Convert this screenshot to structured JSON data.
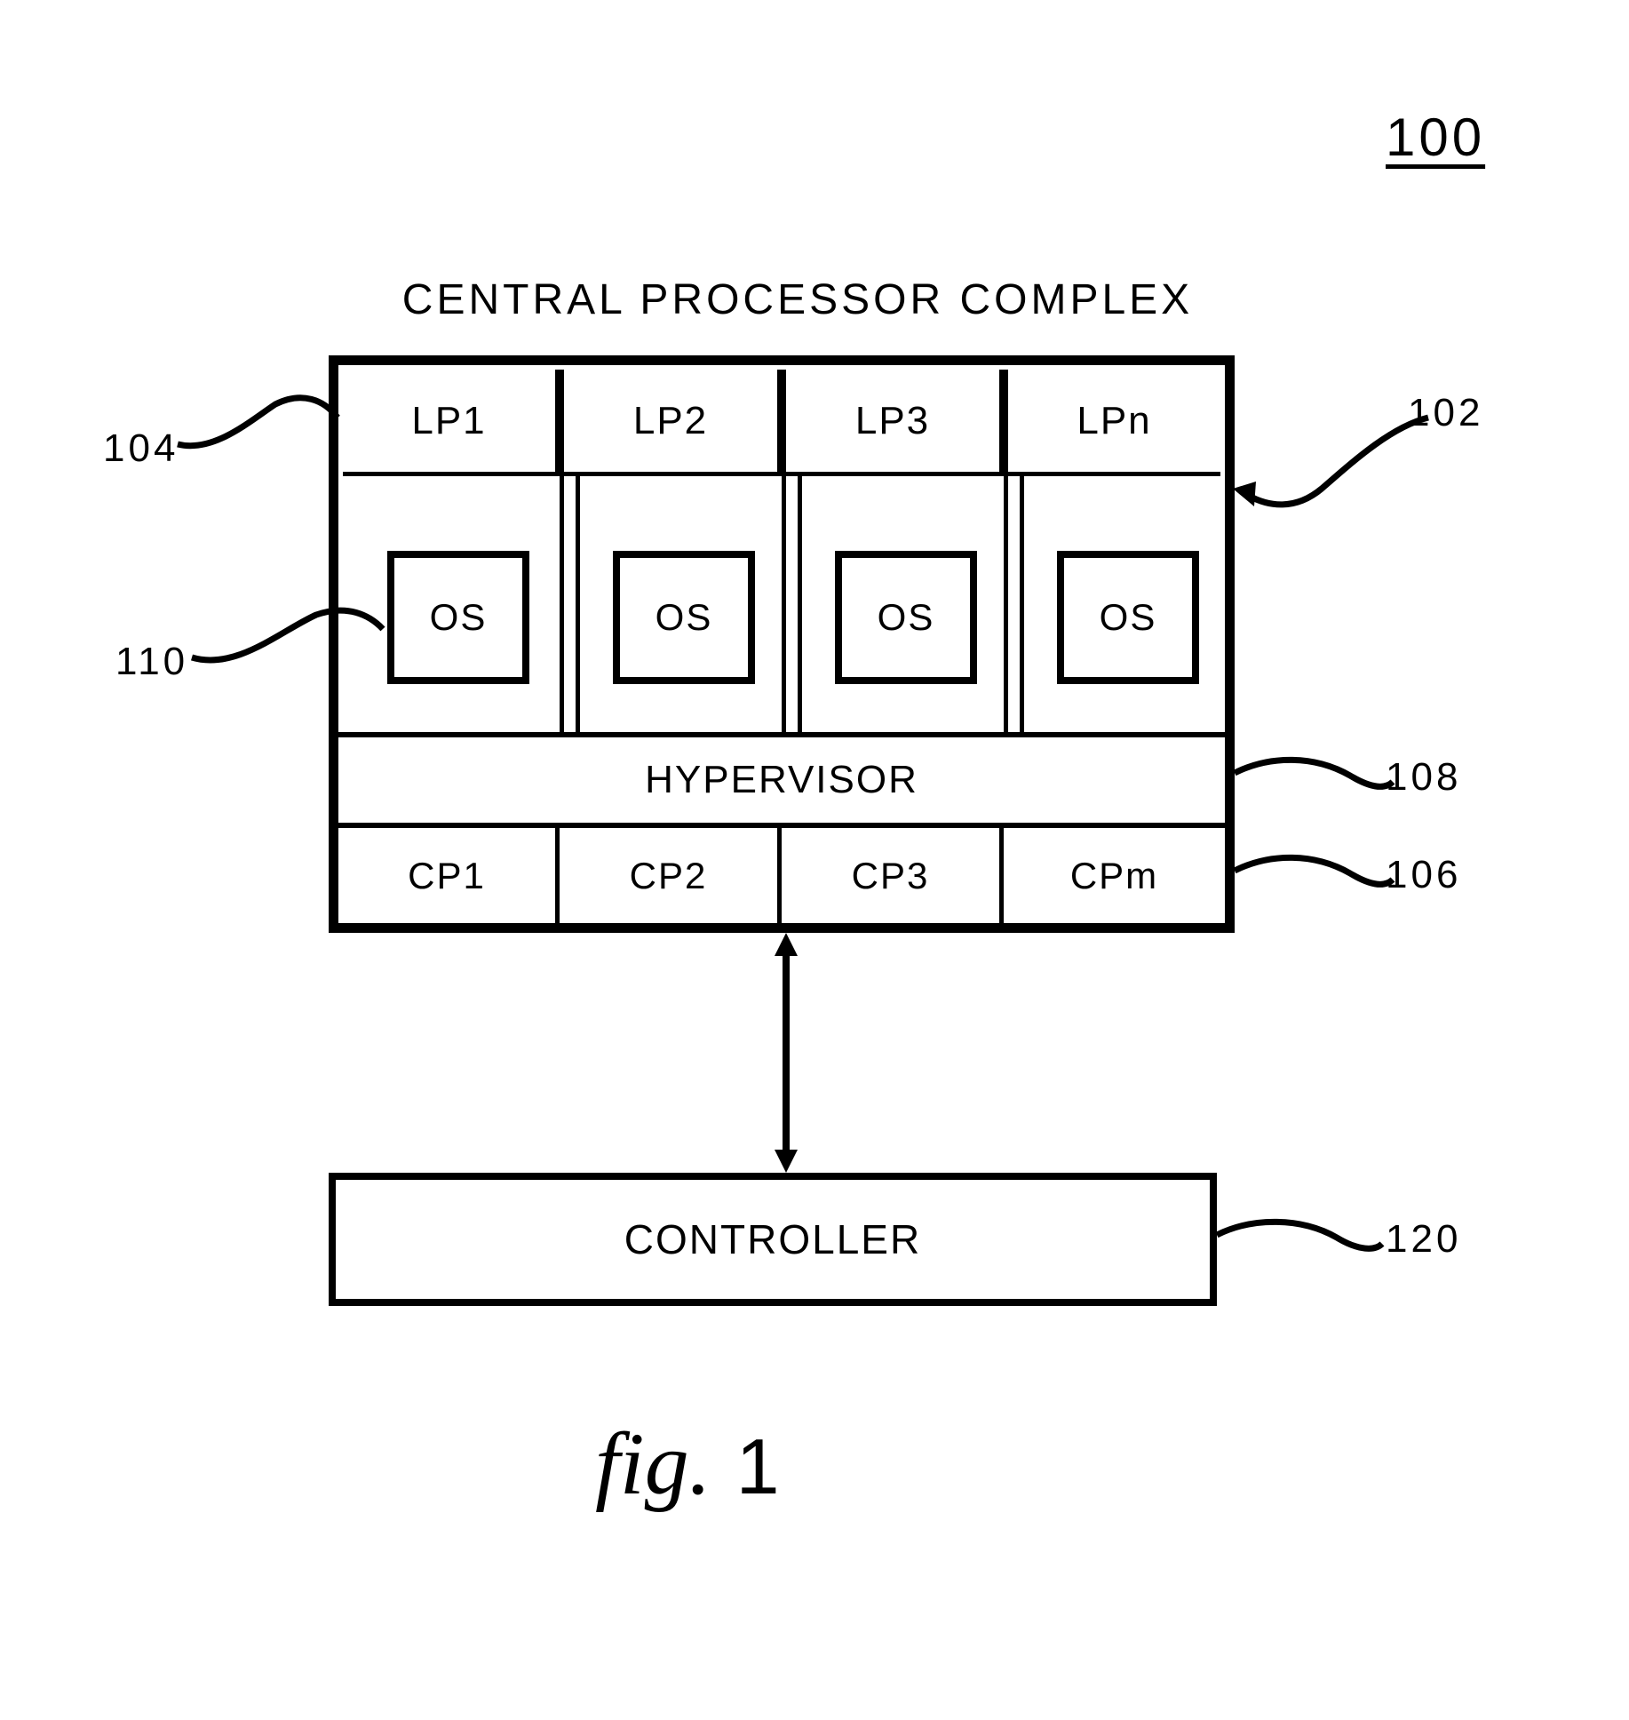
{
  "figure_number_label": "100",
  "title": "CENTRAL PROCESSOR COMPLEX",
  "lp": [
    "LP1",
    "LP2",
    "LP3",
    "LPn"
  ],
  "os": [
    "OS",
    "OS",
    "OS",
    "OS"
  ],
  "hypervisor": "HYPERVISOR",
  "cp": [
    "CP1",
    "CP2",
    "CP3",
    "CPm"
  ],
  "controller": "CONTROLLER",
  "callouts": {
    "partition": "104",
    "os": "110",
    "cpc": "102",
    "hyper": "108",
    "cp": "106",
    "controller": "120"
  },
  "caption_prefix": "fig.",
  "caption_number": "1"
}
